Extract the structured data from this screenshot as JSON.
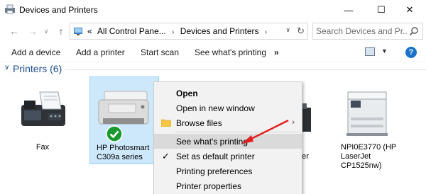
{
  "window": {
    "title": "Devices and Printers",
    "min_glyph": "—",
    "max_glyph": "☐",
    "close_glyph": "✕"
  },
  "nav": {
    "back_glyph": "←",
    "forward_glyph": "→",
    "history_glyph": "∨",
    "up_glyph": "↑",
    "breadcrumb_prefix": "«",
    "breadcrumb": [
      "All Control Pane...",
      "Devices and Printers"
    ],
    "breadcrumb_sep": "›",
    "dropdown_glyph": "∨",
    "refresh_glyph": "↻",
    "search_placeholder": "Search Devices and Pr..."
  },
  "commands": {
    "add_device": "Add a device",
    "add_printer": "Add a printer",
    "start_scan": "Start scan",
    "see_printing": "See what's printing",
    "more": "»",
    "view_dropdown": "▼",
    "help": "?"
  },
  "group": {
    "chevron": "∨",
    "label": "Printers (6)"
  },
  "devices": {
    "fax": {
      "label": "Fax"
    },
    "hp": {
      "line1": "HP Photosmart",
      "line2": "C309a series"
    },
    "mid": {
      "line1": "S",
      "line2": "riter"
    },
    "npi": {
      "line1": "NPI0E3770 (HP",
      "line2": "LaserJet",
      "line3": "CP1525nw)"
    }
  },
  "context_menu": {
    "open": "Open",
    "open_new_window": "Open in new window",
    "browse_files": "Browse files",
    "see_printing": "See what's printing",
    "set_default": "Set as default printer",
    "preferences": "Printing preferences",
    "properties": "Printer properties",
    "submenu_arrow": "›",
    "check_glyph": "✓"
  },
  "colors": {
    "accent": "#1e4e8c",
    "selection": "#cde8fb",
    "annotation_arrow": "#e02020",
    "default_badge": "#1a9a2e"
  }
}
